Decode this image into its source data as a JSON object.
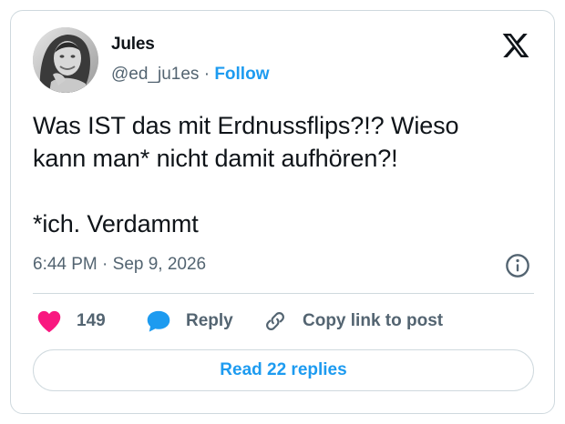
{
  "author": {
    "name": "Jules",
    "handle": "@ed_ju1es",
    "separator": "·",
    "follow_label": "Follow"
  },
  "tweet": {
    "text": "Was IST das mit Erdnussflips?!? Wieso\nkann man* nicht damit aufhören?!\n\n*ich. Verdammt",
    "timestamp": "6:44 PM · Sep 9, 2026"
  },
  "actions": {
    "like_count": "149",
    "reply_label": "Reply",
    "copy_link_label": "Copy link to post"
  },
  "footer": {
    "read_replies_label": "Read 22 replies"
  },
  "icons": {
    "brand": "x-logo-icon",
    "info": "info-icon",
    "like": "heart-icon",
    "reply": "speech-bubble-icon",
    "copy": "link-icon"
  },
  "colors": {
    "accent": "#1d9bf0",
    "heart": "#f91880",
    "muted_text": "#536471",
    "border": "#cfd9de"
  }
}
